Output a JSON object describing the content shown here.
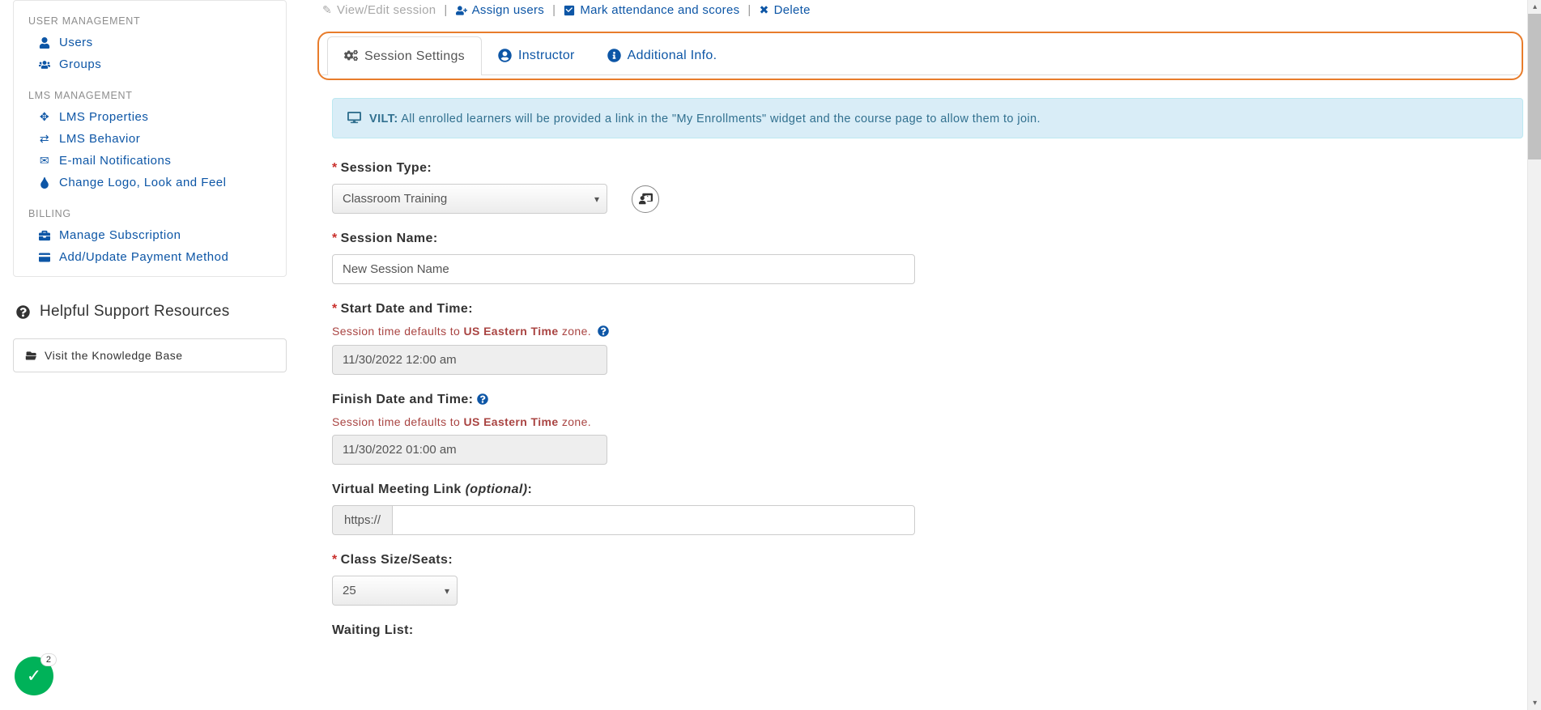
{
  "sidebar": {
    "sections": [
      {
        "heading": "USER MANAGEMENT",
        "items": [
          {
            "icon": "user-icon",
            "label": "Users"
          },
          {
            "icon": "users-icon",
            "label": "Groups"
          }
        ]
      },
      {
        "heading": "LMS MANAGEMENT",
        "items": [
          {
            "icon": "move-icon",
            "label": "LMS Properties"
          },
          {
            "icon": "exchange-icon",
            "label": "LMS Behavior"
          },
          {
            "icon": "envelope-icon",
            "label": "E-mail Notifications"
          },
          {
            "icon": "tint-icon",
            "label": "Change Logo, Look and Feel"
          }
        ]
      },
      {
        "heading": "BILLING",
        "items": [
          {
            "icon": "briefcase-icon",
            "label": "Manage Subscription"
          },
          {
            "icon": "credit-card-icon",
            "label": "Add/Update Payment Method"
          }
        ]
      }
    ],
    "support_heading": "Helpful Support Resources",
    "kb_button": "Visit the Knowledge Base"
  },
  "action_bar": {
    "view_edit": "View/Edit session",
    "assign": "Assign users",
    "mark": "Mark attendance and scores",
    "delete": "Delete"
  },
  "tabs": [
    {
      "icon": "cogs-icon",
      "label": "Session Settings",
      "active": true
    },
    {
      "icon": "user-circle-icon",
      "label": "Instructor",
      "active": false
    },
    {
      "icon": "info-icon",
      "label": "Additional Info.",
      "active": false
    }
  ],
  "alert": {
    "prefix": "VILT:",
    "text": "All enrolled learners will be provided a link in the \"My Enrollments\" widget and the course page to allow them to join."
  },
  "form": {
    "session_type": {
      "label": "Session Type:",
      "value": "Classroom Training"
    },
    "session_name": {
      "label": "Session Name:",
      "value": "New Session Name"
    },
    "start": {
      "label": "Start Date and Time:",
      "hint_prefix": "Session time defaults to ",
      "hint_bold": "US Eastern Time",
      "hint_suffix": " zone.",
      "value": "11/30/2022 12:00 am"
    },
    "finish": {
      "label": "Finish Date and Time:",
      "hint_prefix": "Session time defaults to ",
      "hint_bold": "US Eastern Time",
      "hint_suffix": " zone.",
      "value": "11/30/2022 01:00 am"
    },
    "meeting_link": {
      "label_main": "Virtual Meeting Link ",
      "label_opt": "(optional)",
      "label_colon": ":",
      "addon": "https://",
      "value": ""
    },
    "class_size": {
      "label": "Class Size/Seats:",
      "value": "25"
    },
    "waiting_list": {
      "label": "Waiting List:"
    }
  },
  "badge_count": "2"
}
